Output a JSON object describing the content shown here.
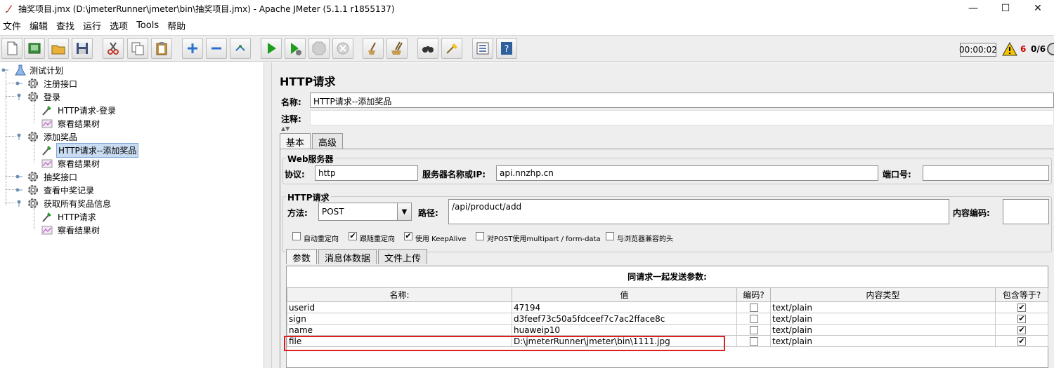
{
  "window": {
    "title": "抽奖项目.jmx (D:\\jmeterRunner\\jmeter\\bin\\抽奖项目.jmx) - Apache JMeter (5.1.1 r1855137)",
    "minimize": "—",
    "maximize": "☐",
    "close": "✕"
  },
  "menu": [
    "文件",
    "编辑",
    "查找",
    "运行",
    "选项",
    "Tools",
    "帮助"
  ],
  "toolbar": {
    "timer": "00:00:02",
    "error_count": "6",
    "threads": "0/6",
    "buttons": [
      "new-icon",
      "templates-icon",
      "open-icon",
      "save-icon",
      "cut-icon",
      "copy-icon",
      "paste-icon",
      "expand-icon",
      "collapse-icon",
      "toggle-icon",
      "start-icon",
      "start-no-pause-icon",
      "stop-icon",
      "shutdown-icon",
      "clear-icon",
      "clear-all-icon",
      "search-icon",
      "reset-search-icon",
      "function-helper-icon",
      "help-icon"
    ]
  },
  "tree": {
    "root": "测试计划",
    "items": [
      {
        "label": "注册接口",
        "type": "thread-group"
      },
      {
        "label": "登录",
        "type": "thread-group"
      },
      {
        "label": "HTTP请求-登录",
        "type": "sampler"
      },
      {
        "label": "察看结果树",
        "type": "listener"
      },
      {
        "label": "添加奖品",
        "type": "thread-group"
      },
      {
        "label": "HTTP请求--添加奖品",
        "type": "sampler"
      },
      {
        "label": "察看结果树",
        "type": "listener"
      },
      {
        "label": "抽奖接口",
        "type": "thread-group"
      },
      {
        "label": "查看中奖记录",
        "type": "thread-group"
      },
      {
        "label": "获取所有奖品信息",
        "type": "thread-group"
      },
      {
        "label": "HTTP请求",
        "type": "sampler"
      },
      {
        "label": "察看结果树",
        "type": "listener"
      }
    ]
  },
  "panel": {
    "title": "HTTP请求",
    "name_label": "名称:",
    "name_value": "HTTP请求--添加奖品",
    "comment_label": "注释:",
    "comment_value": "",
    "tabs": [
      "基本",
      "高级"
    ],
    "web_server_group": "Web服务器",
    "protocol_label": "协议:",
    "protocol_value": "http",
    "server_label": "服务器名称或IP:",
    "server_value": "api.nnzhp.cn",
    "port_label": "端口号:",
    "port_value": "",
    "http_request_group": "HTTP请求",
    "method_label": "方法:",
    "method_value": "POST",
    "path_label": "路径:",
    "path_value": "/api/product/add",
    "encoding_label": "内容编码:",
    "encoding_value": "",
    "options": [
      {
        "label": "自动重定向",
        "checked": false
      },
      {
        "label": "跟随重定向",
        "checked": true
      },
      {
        "label": "使用 KeepAlive",
        "checked": true
      },
      {
        "label": "对POST使用multipart / form-data",
        "checked": false
      },
      {
        "label": "与浏览器兼容的头",
        "checked": false
      }
    ],
    "subtabs": [
      "参数",
      "消息体数据",
      "文件上传"
    ],
    "params_caption": "同请求一起发送参数:",
    "columns": [
      "名称:",
      "值",
      "编码?",
      "内容类型",
      "包含等于?"
    ],
    "rows": [
      {
        "name": "userid",
        "value": "47194",
        "encode": false,
        "content_type": "text/plain",
        "include_equals": true
      },
      {
        "name": "sign",
        "value": "d3feef73c50a5fdceef7c7ac2fface8c",
        "encode": false,
        "content_type": "text/plain",
        "include_equals": true
      },
      {
        "name": "name",
        "value": "huaweip10",
        "encode": false,
        "content_type": "text/plain",
        "include_equals": true
      },
      {
        "name": "file",
        "value": "D:\\jmeterRunner\\jmeter\\bin\\1111.jpg",
        "encode": false,
        "content_type": "text/plain",
        "include_equals": true
      }
    ]
  },
  "colors": {
    "highlight": "#e02020",
    "selection": "#c9dcf2",
    "warning": "#f5c400"
  }
}
